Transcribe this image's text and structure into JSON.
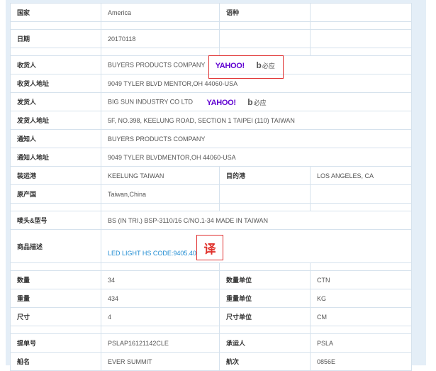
{
  "rows": {
    "country": {
      "label": "国家",
      "value": "America",
      "label2": "语种",
      "value2": ""
    },
    "date": {
      "label": "日期",
      "value": "20170118"
    },
    "consignee": {
      "label": "收货人",
      "value": "BUYERS PRODUCTS COMPANY"
    },
    "consignee_addr": {
      "label": "收货人地址",
      "value": "9049 TYLER BLVD MENTOR,OH 44060-USA"
    },
    "shipper": {
      "label": "发货人",
      "value": "BIG SUN INDUSTRY CO LTD"
    },
    "shipper_addr": {
      "label": "发货人地址",
      "value": "5F, NO.398, KEELUNG ROAD, SECTION 1 TAIPEI (110) TAIWAN"
    },
    "notify": {
      "label": "通知人",
      "value": "BUYERS PRODUCTS COMPANY"
    },
    "notify_addr": {
      "label": "通知人地址",
      "value": "9049 TYLER BLVDMENTOR,OH 44060-USA"
    },
    "port_load": {
      "label": "装运港",
      "value": "KEELUNG TAIWAN",
      "label2": "目的港",
      "value2": "LOS ANGELES, CA"
    },
    "origin": {
      "label": "原产国",
      "value": "Taiwan,China"
    },
    "marks": {
      "label": "唛头&型号",
      "value": "BS (IN TRI.) BSP-3110/16 C/NO.1-34 MADE IN TAIWAN"
    },
    "goods": {
      "label": "商品描述",
      "value": "LED LIGHT HS CODE:9405.40"
    },
    "qty": {
      "label": "数量",
      "value": "34",
      "label2": "数量单位",
      "value2": "CTN"
    },
    "weight": {
      "label": "重量",
      "value": "434",
      "label2": "重量单位",
      "value2": "KG"
    },
    "size": {
      "label": "尺寸",
      "value": "4",
      "label2": "尺寸单位",
      "value2": "CM"
    },
    "bill": {
      "label": "提单号",
      "value": "PSLAP16121142CLE",
      "label2": "承运人",
      "value2": "PSLA"
    },
    "vessel": {
      "label": "船名",
      "value": "EVER SUMMIT",
      "label2": "航次",
      "value2": "0856E"
    }
  },
  "search": {
    "yahoo": "YAHOO!",
    "bing_suffix": "必应"
  },
  "translate_label": "译",
  "colors": {
    "yahoo": "#5f01d1",
    "link": "#1e8bd2",
    "highlight": "#e03030",
    "panel": "#e4eef7"
  }
}
